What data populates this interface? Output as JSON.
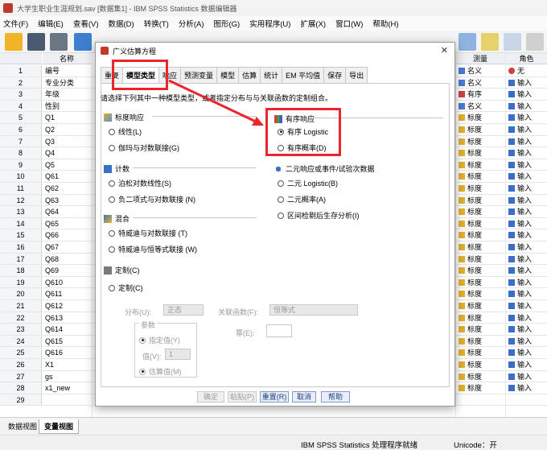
{
  "window": {
    "title": "大学生职业生涯规划.sav [数据集1] - IBM SPSS Statistics 数据编辑器"
  },
  "menu": [
    "文件(F)",
    "编辑(E)",
    "查看(V)",
    "数据(D)",
    "转换(T)",
    "分析(A)",
    "图形(G)",
    "实用程序(U)",
    "扩展(X)",
    "窗口(W)",
    "帮助(H)"
  ],
  "grid": {
    "headers": {
      "name": "名称",
      "measure": "测量",
      "role": "角色"
    },
    "rows": [
      {
        "num": "1",
        "name": "编号",
        "measure": "名义",
        "role": "无"
      },
      {
        "num": "2",
        "name": "专业分类",
        "measure": "名义",
        "role": "输入"
      },
      {
        "num": "3",
        "name": "年级",
        "measure": "有序",
        "role": "输入"
      },
      {
        "num": "4",
        "name": "性别",
        "measure": "名义",
        "role": "输入"
      },
      {
        "num": "5",
        "name": "Q1",
        "measure": "标度",
        "role": "输入"
      },
      {
        "num": "6",
        "name": "Q2",
        "measure": "标度",
        "role": "输入"
      },
      {
        "num": "7",
        "name": "Q3",
        "measure": "标度",
        "role": "输入"
      },
      {
        "num": "8",
        "name": "Q4",
        "measure": "标度",
        "role": "输入"
      },
      {
        "num": "9",
        "name": "Q5",
        "measure": "标度",
        "role": "输入"
      },
      {
        "num": "10",
        "name": "Q61",
        "measure": "标度",
        "role": "输入"
      },
      {
        "num": "11",
        "name": "Q62",
        "measure": "标度",
        "role": "输入"
      },
      {
        "num": "12",
        "name": "Q63",
        "measure": "标度",
        "role": "输入"
      },
      {
        "num": "13",
        "name": "Q64",
        "measure": "标度",
        "role": "输入"
      },
      {
        "num": "14",
        "name": "Q65",
        "measure": "标度",
        "role": "输入"
      },
      {
        "num": "15",
        "name": "Q66",
        "measure": "标度",
        "role": "输入"
      },
      {
        "num": "16",
        "name": "Q67",
        "measure": "标度",
        "role": "输入"
      },
      {
        "num": "17",
        "name": "Q68",
        "measure": "标度",
        "role": "输入"
      },
      {
        "num": "18",
        "name": "Q69",
        "measure": "标度",
        "role": "输入"
      },
      {
        "num": "19",
        "name": "Q610",
        "measure": "标度",
        "role": "输入"
      },
      {
        "num": "20",
        "name": "Q611",
        "measure": "标度",
        "role": "输入"
      },
      {
        "num": "21",
        "name": "Q612",
        "measure": "标度",
        "role": "输入"
      },
      {
        "num": "22",
        "name": "Q613",
        "measure": "标度",
        "role": "输入"
      },
      {
        "num": "23",
        "name": "Q614",
        "measure": "标度",
        "role": "输入"
      },
      {
        "num": "24",
        "name": "Q615",
        "measure": "标度",
        "role": "输入"
      },
      {
        "num": "25",
        "name": "Q616",
        "measure": "标度",
        "role": "输入"
      },
      {
        "num": "26",
        "name": "X1",
        "measure": "标度",
        "role": "输入"
      },
      {
        "num": "27",
        "name": "gs",
        "measure": "标度",
        "role": "输入"
      },
      {
        "num": "28",
        "name": "x1_new",
        "measure": "标度",
        "role": "输入"
      },
      {
        "num": "29",
        "name": "",
        "measure": "",
        "role": ""
      }
    ]
  },
  "bottom_tabs": [
    "数据视图",
    "变量视图"
  ],
  "status": {
    "processor": "IBM SPSS Statistics 处理程序就绪",
    "unicode": "Unicode：开"
  },
  "dialog": {
    "title": "广义估算方程",
    "close": "✕",
    "tabs": [
      "重复",
      "模型类型",
      "响应",
      "预测变量",
      "模型",
      "估算",
      "统计",
      "EM 平均值",
      "保存",
      "导出"
    ],
    "instruction": "请选择下列其中一种模型类型，或者指定分布与与关联函数的定制组合。",
    "groups": {
      "scale": {
        "title": "标度响应",
        "options": [
          "线性(L)",
          "伽玛与对数联接(G)"
        ]
      },
      "ordinal": {
        "title": "有序响应",
        "options": [
          "有序 Logistic",
          "有序概率(D)"
        ]
      },
      "count": {
        "title": "计数",
        "options": [
          "泊松对数线性(S)",
          "负二项式与对数联接 (N)"
        ]
      },
      "binary": {
        "title": "二元响应或事件/试验次数据",
        "options": [
          "二元 Logistic(B)",
          "二元概率(A)",
          "区间检剔后生存分析(I)"
        ]
      },
      "mixture": {
        "title": "混合",
        "options": [
          "特威迪与对数联接 (T)",
          "特威迪与恒等式联接 (W)"
        ]
      },
      "custom": {
        "title": "定制(C)",
        "option": "定制(C)"
      }
    },
    "custom_fields": {
      "distribution_label": "分布(U):",
      "distribution_value": "正态",
      "link_label": "关联函数(F):",
      "link_value": "恒等式",
      "power_label": "幂(E):",
      "param_title": "参数",
      "specify_label": "指定值(Y)",
      "value_label": "值(V):",
      "value_value": "1",
      "estimate_label": "估算值(M)"
    },
    "buttons": [
      "确定",
      "粘贴(P)",
      "重置(R)",
      "取消",
      "帮助"
    ]
  },
  "colors": {
    "highlight": "#e8262c",
    "arrow": "#e8262c"
  }
}
